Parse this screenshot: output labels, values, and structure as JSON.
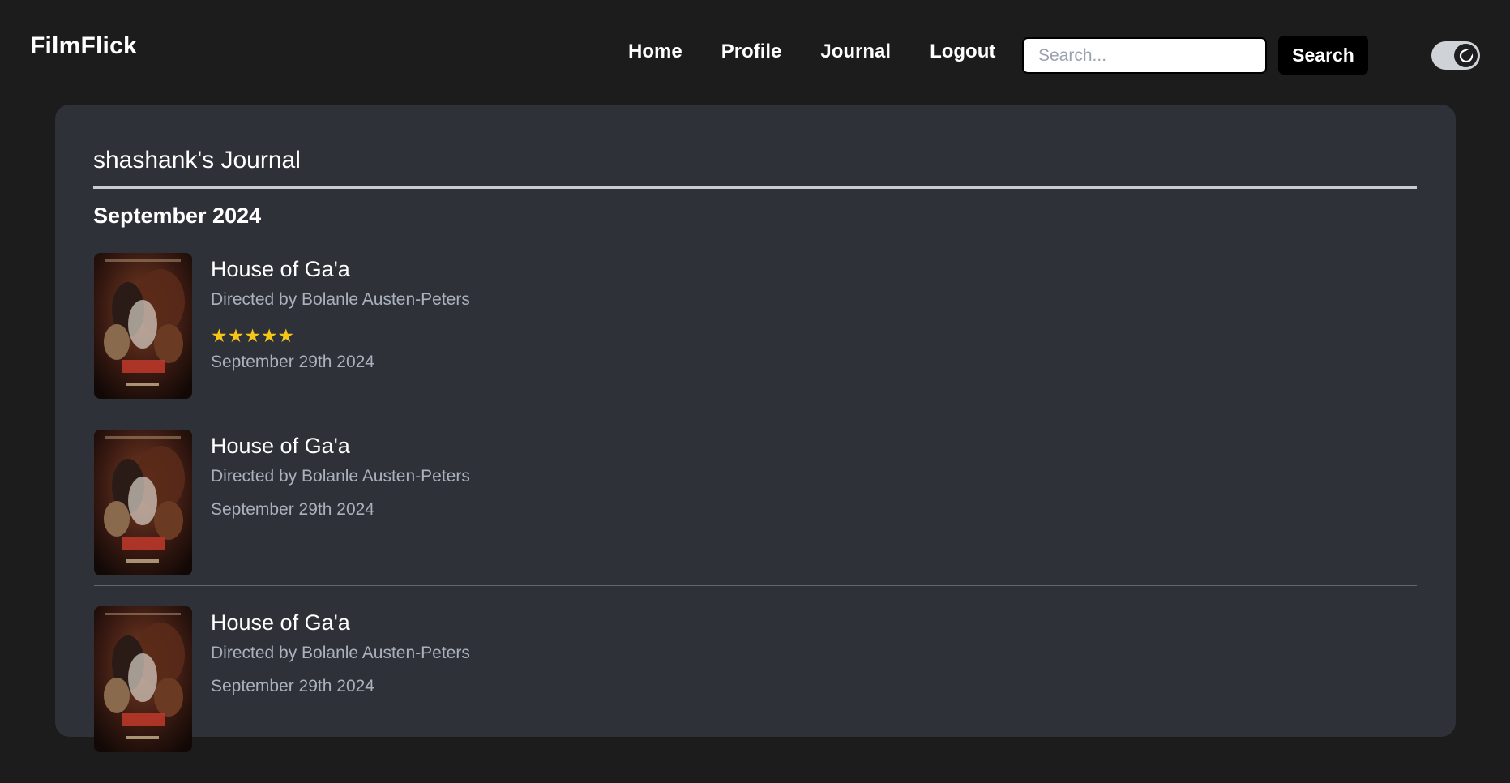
{
  "navbar": {
    "brand": "FilmFlick",
    "links": [
      "Home",
      "Profile",
      "Journal",
      "Logout"
    ],
    "search_placeholder": "Search...",
    "search_value": "",
    "search_button": "Search",
    "theme_toggle": "dark-mode-icon"
  },
  "journal": {
    "title": "shashank's Journal",
    "month": "September 2024",
    "entries": [
      {
        "title": "House of Ga'a",
        "director": "Directed by Bolanle Austen-Peters",
        "rating": 5,
        "stars": "★★★★★",
        "date": "September 29th 2024",
        "poster_icon": "movie-poster"
      },
      {
        "title": "House of Ga'a",
        "director": "Directed by Bolanle Austen-Peters",
        "date": "September 29th 2024",
        "poster_icon": "movie-poster"
      },
      {
        "title": "House of Ga'a",
        "director": "Directed by Bolanle Austen-Peters",
        "date": "September 29th 2024",
        "poster_icon": "movie-poster"
      }
    ]
  },
  "colors": {
    "background": "#1c1c1d",
    "card": "#2e3138",
    "muted_text": "#aab1bd",
    "star": "#f5c518",
    "search_button": "#000000"
  }
}
